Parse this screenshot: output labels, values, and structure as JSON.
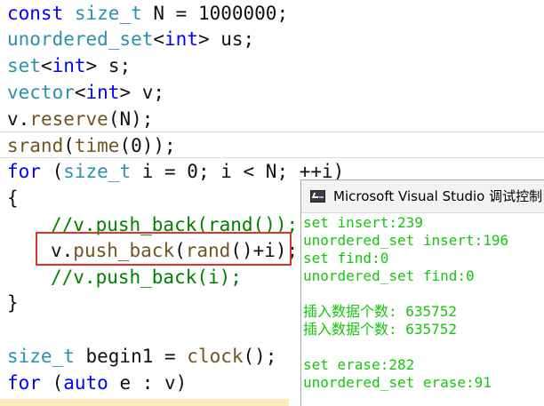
{
  "editor": {
    "lines": [
      {
        "t1": "const",
        "t2": " ",
        "t3": "size_t",
        "t4": " N = 1000000;"
      },
      {
        "t1": "unordered_set",
        "t2": "<",
        "t3": "int",
        "t4": "> us;"
      },
      {
        "t1": "set",
        "t2": "<",
        "t3": "int",
        "t4": "> s;"
      },
      {
        "t1": "vector",
        "t2": "<",
        "t3": "int",
        "t4": "> v;"
      },
      {
        "t1": "v.",
        "t2": "reserve",
        "t3": "(N);"
      },
      {
        "t1": "srand",
        "t2": "(",
        "t3": "time",
        "t4": "(0));"
      },
      {
        "t1": "for",
        "t2": " (",
        "t3": "size_t",
        "t4": " i = 0; i < N; ++i)"
      },
      {
        "t1": "{"
      },
      {
        "t1": "//v.push_back(rand());"
      },
      {
        "t1": "v.",
        "t2": "push_back",
        "t3": "(",
        "t4": "rand",
        "t5": "()+i);"
      },
      {
        "t1": "//v.push_back(i);"
      },
      {
        "t1": "}"
      },
      {
        "t1": ""
      },
      {
        "t1": "size_t",
        "t2": " begin1 = ",
        "t3": "clock",
        "t4": "();"
      },
      {
        "t1": "for",
        "t2": " (",
        "t3": "auto",
        "t4": " e : v)"
      }
    ]
  },
  "console": {
    "title": "Microsoft Visual Studio 调试控制台",
    "output": [
      "set insert:239",
      "unordered_set insert:196",
      "set find:0",
      "unordered_set find:0",
      "",
      "插入数据个数: 635752",
      "插入数据个数: 635752",
      "",
      "set erase:282",
      "unordered_set erase:91"
    ]
  },
  "colors": {
    "keyword": "#0000ff",
    "type": "#2b91af",
    "function": "#74531f",
    "comment": "#008000",
    "console_text": "#16c60c",
    "highlight_box": "#e0332b"
  },
  "icons": {
    "console_app": "console-app-icon"
  }
}
